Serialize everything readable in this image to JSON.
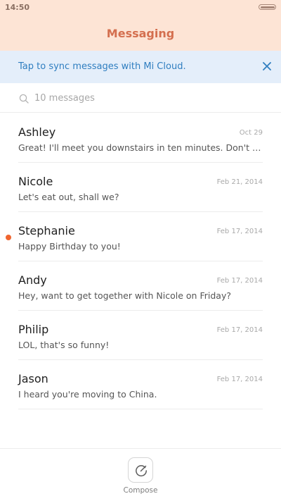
{
  "status_bar": {
    "time": "14:50"
  },
  "header": {
    "title": "Messaging"
  },
  "sync_banner": {
    "text": "Tap to sync messages with Mi Cloud.",
    "close_icon": "close-icon"
  },
  "search": {
    "placeholder": "10 messages",
    "icon": "search-icon"
  },
  "messages": [
    {
      "name": "Ashley",
      "date": "Oct 29",
      "preview": "Great! I'll meet you downstairs in ten minutes. Don't forget to bring the tickets!",
      "unread": false
    },
    {
      "name": "Nicole",
      "date": "Feb 21, 2014",
      "preview": "Let's eat out, shall we?",
      "unread": false
    },
    {
      "name": "Stephanie",
      "date": "Feb 17, 2014",
      "preview": "Happy Birthday to you!",
      "unread": true
    },
    {
      "name": "Andy",
      "date": "Feb 17, 2014",
      "preview": "Hey, want to get together with Nicole on Friday?",
      "unread": false
    },
    {
      "name": "Philip",
      "date": "Feb 17, 2014",
      "preview": "LOL, that's so funny!",
      "unread": false
    },
    {
      "name": "Jason",
      "date": "Feb 17, 2014",
      "preview": "I heard you're moving to China.",
      "unread": false
    }
  ],
  "compose": {
    "label": "Compose",
    "icon": "compose-icon"
  },
  "colors": {
    "header_bg": "#fde4d5",
    "title": "#d46f4f",
    "banner_bg": "#e4eefa",
    "banner_text": "#2f7ec0",
    "unread_dot": "#f0652f"
  }
}
